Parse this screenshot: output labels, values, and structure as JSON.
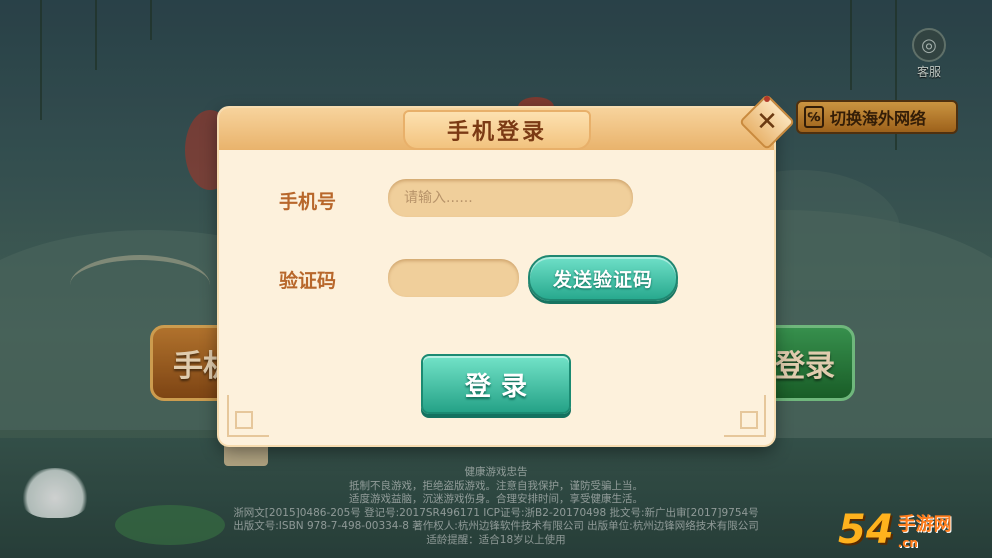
{
  "service": {
    "label": "客服",
    "icon": "headset-icon"
  },
  "switch_network": {
    "label": "切换海外网络",
    "icon": "wifi-icon"
  },
  "background": {
    "left_button_text": "手机",
    "right_button_text": "登录",
    "footer_lines": [
      "健康游戏忠告",
      "抵制不良游戏，拒绝盗版游戏。注意自我保护，谨防受骗上当。",
      "适度游戏益脑，沉迷游戏伤身。合理安排时间，享受健康生活。",
      "浙网文[2015]0486-205号   登记号:2017SR496171   ICP证号:浙B2-20170498   批文号:新广出审[2017]9754号",
      "出版文号:ISBN 978-7-498-00334-8   著作权人:杭州边锋软件技术有限公司   出版单位:杭州边锋网络技术有限公司",
      "适龄提醒：适合18岁以上使用"
    ]
  },
  "dialog": {
    "title": "手机登录",
    "close_icon": "close-icon",
    "phone_label": "手机号",
    "phone_placeholder": "请输入......",
    "phone_value": "",
    "code_label": "验证码",
    "code_value": "",
    "send_code_label": "发送验证码",
    "login_label": "登录"
  },
  "watermark": {
    "number": "54",
    "site_cn": "手游网",
    "site_url": ".cn"
  },
  "colors": {
    "dialog_bg": "#fdf1dc",
    "header": "#e9b36c",
    "label": "#b8672b",
    "teal_button": "#28a98e",
    "input_bg": "#f0cf9b"
  }
}
